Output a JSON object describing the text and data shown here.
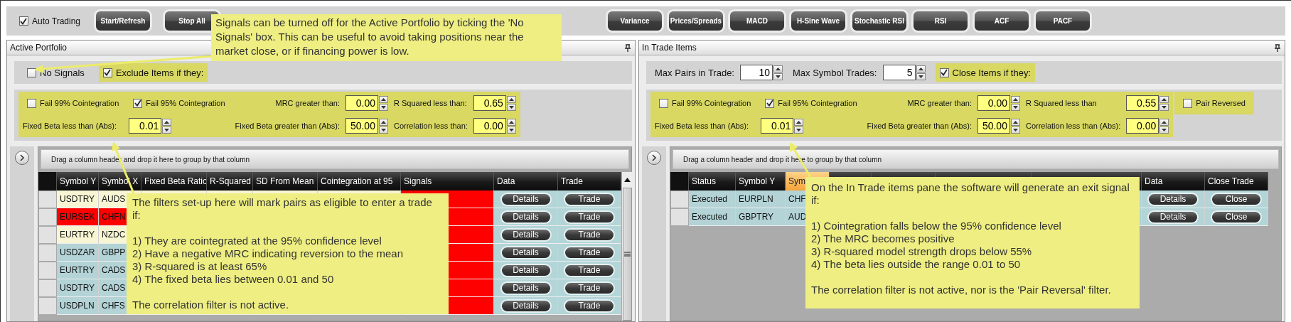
{
  "toolbar": {
    "auto_trading": {
      "label": "Auto Trading",
      "checked": true
    },
    "button_groups": [
      [
        "Start/Refresh",
        "Stop All"
      ],
      [
        "Variance",
        "Prices/Spreads",
        "MACD",
        "H-Sine Wave",
        "Stochastic RSI",
        "RSI",
        "ACF",
        "PACF"
      ]
    ]
  },
  "panels": [
    {
      "title": "Active Portfolio",
      "top_row": [
        {
          "kind": "checkbox",
          "label": "No Signals",
          "checked": false,
          "highlighted": false
        },
        {
          "kind": "checkbox",
          "label": "Exclude Items if they:",
          "checked": true,
          "highlighted": true
        }
      ],
      "filter_groups": [
        {
          "highlighted": true,
          "rows": [
            [
              {
                "kind": "checkbox",
                "label": "Fail 99% Cointegration",
                "checked": false
              },
              {
                "kind": "checkbox",
                "label": "Fail 95% Cointegration",
                "checked": true
              },
              {
                "kind": "label",
                "label": "MRC greater than:"
              },
              {
                "kind": "number",
                "value": "0.00"
              },
              {
                "kind": "label",
                "label": "R Squared less than:"
              },
              {
                "kind": "number",
                "value": "0.65"
              }
            ],
            [
              {
                "kind": "label",
                "label": "Fixed Beta less than (Abs):"
              },
              {
                "kind": "number",
                "value": "0.01"
              },
              {
                "kind": "label",
                "label": "Fixed Beta greater than (Abs):"
              },
              {
                "kind": "number",
                "value": "50.00"
              },
              {
                "kind": "label",
                "label": "Correlation less than:"
              },
              {
                "kind": "number",
                "value": "0.00"
              }
            ]
          ]
        }
      ],
      "group_hint": "Drag a column header and drop it here to group by that column",
      "columns": [
        {
          "label": "Symbol Y",
          "kind": "text",
          "sorted": false
        },
        {
          "label": "Symbol X",
          "kind": "text",
          "sorted": false
        },
        {
          "label": "Fixed Beta Ratio",
          "kind": "text",
          "sorted": false
        },
        {
          "label": "R-Squared",
          "kind": "text",
          "sorted": false
        },
        {
          "label": "SD From Mean",
          "kind": "text",
          "sorted": false
        },
        {
          "label": "Cointegration at 95",
          "kind": "text",
          "sorted": false
        },
        {
          "label": "Signals",
          "kind": "signal",
          "sorted": false
        },
        {
          "label": "Data",
          "kind": "button",
          "sorted": false
        },
        {
          "label": "Trade",
          "kind": "button",
          "sorted": false
        }
      ],
      "rows": [
        {
          "cells": [
            "USDTRY",
            "AUDS"
          ],
          "color": "#f7f5d3",
          "buttons": [
            "Details",
            "Trade"
          ]
        },
        {
          "cells": [
            "EURSEK",
            "CHFN"
          ],
          "color": "#ff0000",
          "buttons": [
            "Details",
            "Trade"
          ]
        },
        {
          "cells": [
            "EURTRY",
            "NZDC"
          ],
          "color": "#f7f5d3",
          "buttons": [
            "Details",
            "Trade"
          ]
        },
        {
          "cells": [
            "USDZAR",
            "GBPP"
          ],
          "color": "#b3d3d6",
          "buttons": [
            "Details",
            "Trade"
          ]
        },
        {
          "cells": [
            "EURTRY",
            "CADS"
          ],
          "color": "#b3d3d6",
          "buttons": [
            "Details",
            "Trade"
          ]
        },
        {
          "cells": [
            "USDTRY",
            "CADS"
          ],
          "color": "#b3d3d6",
          "buttons": [
            "Details",
            "Trade"
          ]
        },
        {
          "cells": [
            "USDPLN",
            "CHFS"
          ],
          "color": "#b3d3d6",
          "buttons": [
            "Details",
            "Trade"
          ]
        }
      ]
    },
    {
      "title": "In Trade Items",
      "top_row": [
        {
          "kind": "label",
          "label": "Max Pairs in Trade:"
        },
        {
          "kind": "number",
          "value": "10"
        },
        {
          "kind": "label",
          "label": "Max Symbol Trades:"
        },
        {
          "kind": "number",
          "value": "5"
        },
        {
          "kind": "checkbox",
          "label": "Close Items if they:",
          "checked": true,
          "highlighted": true
        }
      ],
      "filter_groups": [
        {
          "highlighted": true,
          "rows": [
            [
              {
                "kind": "checkbox",
                "label": "Fail 99% Cointegration",
                "checked": false
              },
              {
                "kind": "checkbox",
                "label": "Fail 95% Cointegration",
                "checked": true
              },
              {
                "kind": "label",
                "label": "MRC greater than:"
              },
              {
                "kind": "number",
                "value": "0.00"
              },
              {
                "kind": "label",
                "label": "R Squared less than"
              },
              {
                "kind": "number",
                "value": "0.55"
              }
            ],
            [
              {
                "kind": "label",
                "label": "Fixed Beta less than (Abs):"
              },
              {
                "kind": "number",
                "value": "0.01"
              },
              {
                "kind": "label",
                "label": "Fixed Beta greater than (Abs):"
              },
              {
                "kind": "number",
                "value": "50.00"
              },
              {
                "kind": "label",
                "label": "Correlation less than (Abs):"
              },
              {
                "kind": "number",
                "value": "0.00"
              }
            ]
          ]
        },
        {
          "highlighted": true,
          "rows": [
            [
              {
                "kind": "checkbox",
                "label": "Pair Reversed",
                "checked": false
              }
            ]
          ]
        }
      ],
      "group_hint": "Drag a column header and drop it here to group by that column",
      "columns": [
        {
          "label": "Status",
          "kind": "text",
          "sorted": false
        },
        {
          "label": "Symbol Y",
          "kind": "text",
          "sorted": false
        },
        {
          "label": "Sym",
          "kind": "text",
          "sorted": true
        },
        {
          "kind": "covered",
          "sorted": false
        },
        {
          "kind": "covered",
          "sorted": false
        },
        {
          "kind": "covered",
          "sorted": false
        },
        {
          "kind": "covered",
          "sorted": false
        },
        {
          "label": "Data",
          "kind": "button",
          "sorted": false
        },
        {
          "label": "Close Trade",
          "kind": "button",
          "sorted": false
        }
      ],
      "rows": [
        {
          "cells": [
            "Executed",
            "EURPLN",
            "CHF"
          ],
          "color": "#b3d3d6",
          "buttons": [
            "Details",
            "Close"
          ]
        },
        {
          "cells": [
            "Executed",
            "GBPTRY",
            "AUD"
          ],
          "color": "#b3d3d6",
          "buttons": [
            "Details",
            "Close"
          ]
        }
      ]
    }
  ],
  "callouts": [
    {
      "paragraphs": [
        [
          "Signals can be turned off for the Active Portfolio by ticking the 'No Signals' box. This can be useful to avoid taking positions near the market close, or if financing power is low."
        ]
      ]
    },
    {
      "paragraphs": [
        [
          "The filters set-up here will mark pairs as eligible to enter a trade if:"
        ],
        [
          "1) They are cointegrated at the 95% confidence level",
          "2) Have a negative MRC indicating reversion to the mean",
          "3) R-squared is at least 65%",
          "4) The fixed beta lies between 0.01 and 50"
        ],
        [
          "The correlation filter is not active."
        ]
      ]
    },
    {
      "paragraphs": [
        [
          "On the In Trade items pane the software will generate an exit signal if:"
        ],
        [
          "1) Cointegration falls below the 95% confidence level",
          "2) The MRC becomes positive",
          "3) R-squared model strength drops below 55%",
          "4) The beta lies outside the range 0.01 to 50"
        ],
        [
          "The correlation filter is not active, nor is the 'Pair Reversal' filter."
        ]
      ]
    }
  ]
}
